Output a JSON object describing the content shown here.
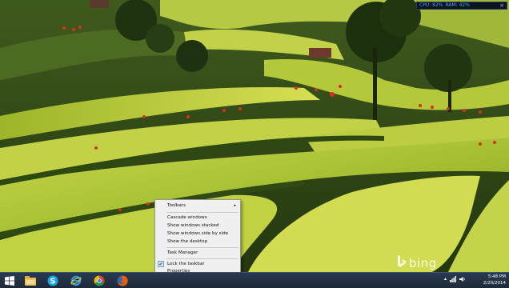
{
  "meter": {
    "cpu": "CPU: 82%",
    "ram": "RAM: 42%",
    "close": "×"
  },
  "watermark": {
    "text": "bing"
  },
  "context_menu": {
    "toolbars": "Toolbars",
    "toolbars_arrow": "▸",
    "cascade": "Cascade windows",
    "stacked": "Show windows stacked",
    "side_by_side": "Show windows side by side",
    "desktop": "Show the desktop",
    "task_manager": "Task Manager",
    "lock": "Lock the taskbar",
    "lock_checked": "✔",
    "properties": "Properties"
  },
  "taskbar": {
    "pinned": [
      "start-button",
      "file-explorer-icon",
      "skype-icon",
      "internet-explorer-icon",
      "chrome-icon",
      "firefox-icon"
    ],
    "tray_up_arrow": "▴"
  },
  "clock": {
    "time": "5:48 PM",
    "date": "2/20/2014"
  }
}
